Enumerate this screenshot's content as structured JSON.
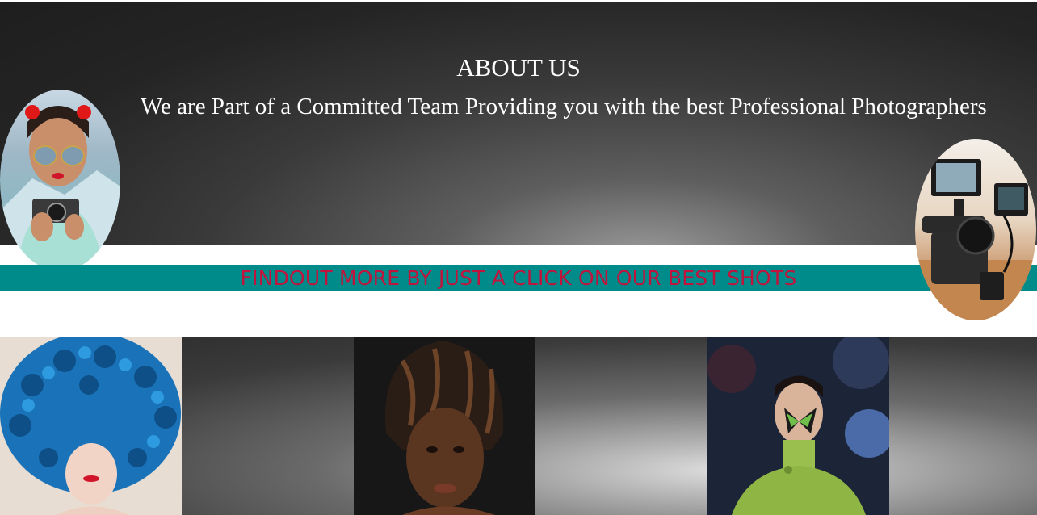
{
  "about": {
    "title": "ABOUT US",
    "subtitle": "We are Part of a Committed Team Providing you with the best Professional Photographers"
  },
  "cta": {
    "text": "FINDOUT MORE BY JUST A CLICK ON OUR BEST SHOTS"
  },
  "colors": {
    "band": "#008b8b",
    "cta_text": "#c0143c",
    "hero_text": "#ffffff"
  },
  "gallery": {
    "shots": [
      {
        "icon": "photo-blue-curly-hair-woman"
      },
      {
        "icon": "photo-dreadlocks-woman"
      },
      {
        "icon": "photo-butterfly-green-outfit-woman"
      }
    ]
  },
  "ovals": {
    "left": "photo-woman-with-camera",
    "right": "photo-camera-rig"
  }
}
